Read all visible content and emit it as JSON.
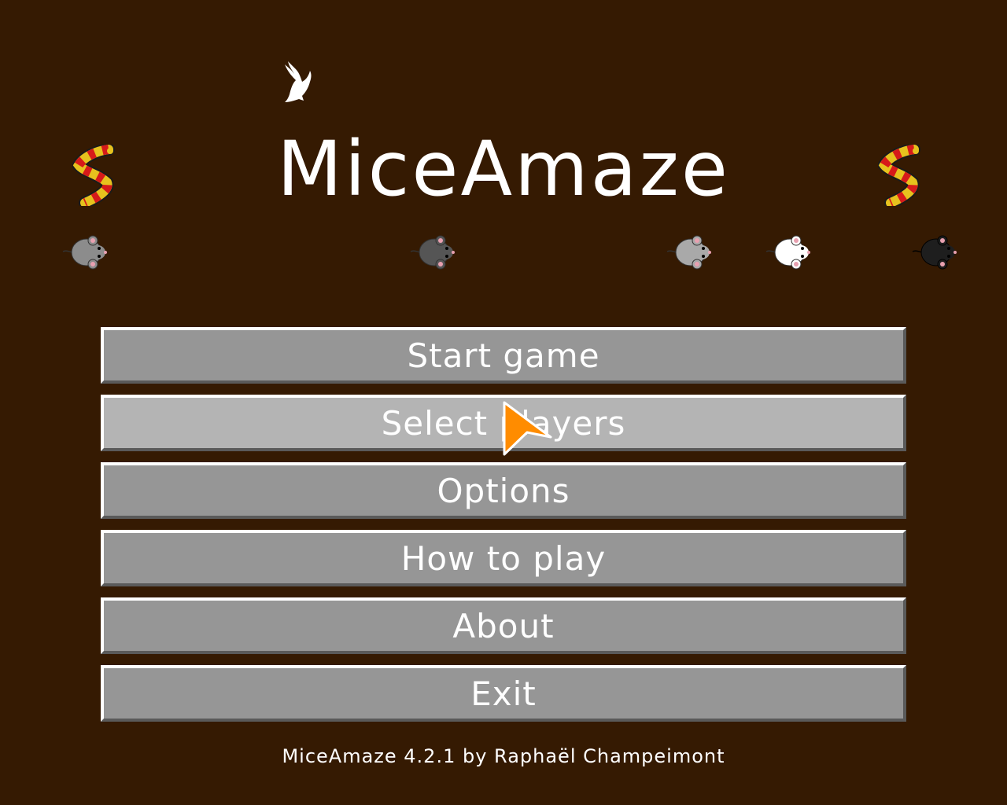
{
  "game": {
    "title": "MiceAmaze",
    "footer": "MiceAmaze 4.2.1 by Raphaël Champeimont"
  },
  "menu": {
    "items": [
      {
        "label": "Start game",
        "state": "normal"
      },
      {
        "label": "Select players",
        "state": "hover"
      },
      {
        "label": "Options",
        "state": "normal"
      },
      {
        "label": "How to play",
        "state": "normal"
      },
      {
        "label": "About",
        "state": "normal"
      },
      {
        "label": "Exit",
        "state": "normal"
      }
    ]
  },
  "sprites": {
    "eagle": "eagle-icon",
    "snakes": [
      "snake-icon",
      "snake-icon"
    ],
    "mice": [
      {
        "icon": "mouse-icon",
        "color": "#8c8c8c"
      },
      {
        "icon": "mouse-icon",
        "color": "#555555"
      },
      {
        "icon": "mouse-icon",
        "color": "#a9a9a9"
      },
      {
        "icon": "mouse-icon",
        "color": "#ffffff"
      },
      {
        "icon": "mouse-icon",
        "color": "#1e1e1e"
      }
    ]
  },
  "colors": {
    "background": "#351a02",
    "button": "#969696",
    "button_hover": "#b4b4b4",
    "cursor": "#ff8c00"
  }
}
